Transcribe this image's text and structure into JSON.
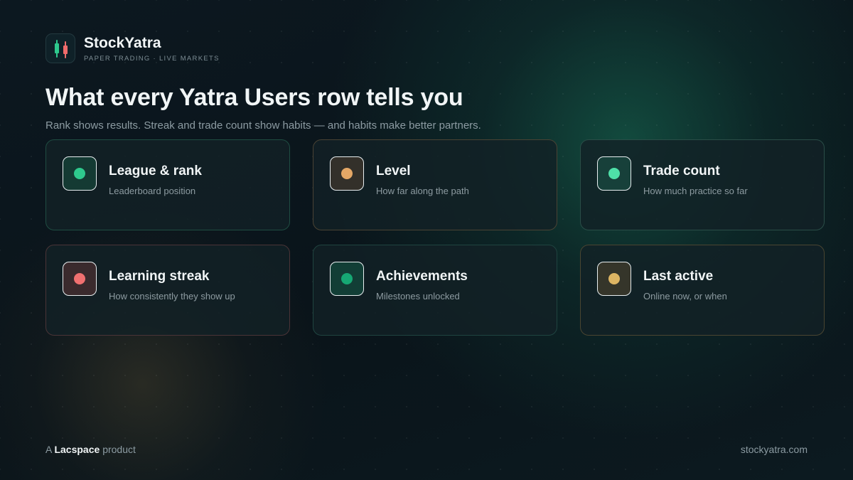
{
  "brand": {
    "name": "StockYatra",
    "tagline": "PAPER TRADING · LIVE MARKETS",
    "logo_icon": "candlestick-icon"
  },
  "headline": {
    "title": "What every Yatra Users row tells you",
    "subtitle": "Rank shows results. Streak and trade count show habits — and habits make better partners."
  },
  "cards": [
    {
      "label": "League & rank",
      "description": "Leaderboard position",
      "dot_color": "#2ec98d"
    },
    {
      "label": "Level",
      "description": "How far along the path",
      "dot_color": "#e4a766"
    },
    {
      "label": "Trade count",
      "description": "How much practice so far",
      "dot_color": "#4fe0a8"
    },
    {
      "label": "Learning streak",
      "description": "How consistently they show up",
      "dot_color": "#f07070"
    },
    {
      "label": "Achievements",
      "description": "Milestones unlocked",
      "dot_color": "#16a874"
    },
    {
      "label": "Last active",
      "description": "Online now, or when",
      "dot_color": "#ddb563"
    }
  ],
  "footer": {
    "prefix": "A",
    "company": "Lacspace",
    "suffix": "product",
    "url": "stockyatra.com"
  }
}
